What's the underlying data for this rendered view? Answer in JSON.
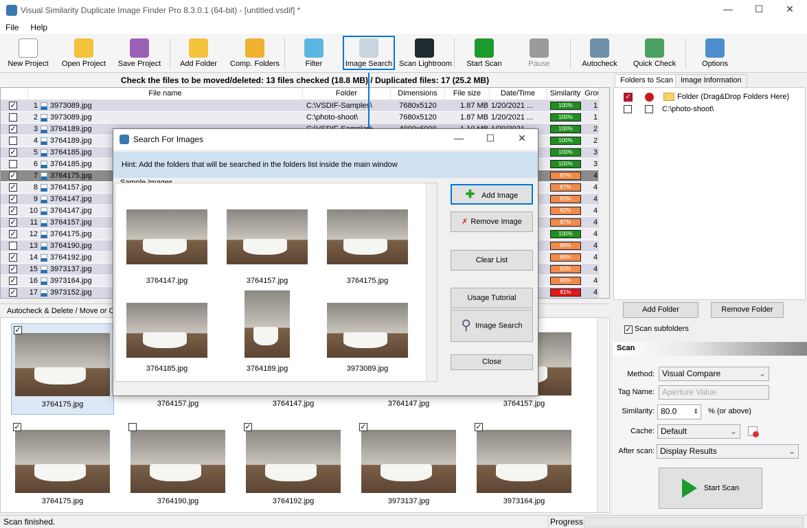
{
  "window": {
    "title": "Visual Similarity Duplicate Image Finder Pro 8.3.0.1 (64-bit) - [untitled.vsdif] *",
    "minimize": "—",
    "maximize": "☐",
    "close": "✕"
  },
  "menu": [
    "File",
    "Help"
  ],
  "toolbar": [
    {
      "label": "New Project",
      "icon": "new-project-icon",
      "color": "#ffffff"
    },
    {
      "label": "Open Project",
      "icon": "open-folder-icon",
      "color": "#f3c23a"
    },
    {
      "label": "Save Project",
      "icon": "floppy-icon",
      "color": "#9c5fb5"
    },
    {
      "label": "Add Folder",
      "icon": "add-folder-icon",
      "color": "#f3c23a"
    },
    {
      "label": "Comp. Folders",
      "icon": "compare-folders-icon",
      "color": "#f0b030"
    },
    {
      "label": "Filter",
      "icon": "funnel-icon",
      "color": "#5bb7e0"
    },
    {
      "label": "Image Search",
      "icon": "magnifier-icon",
      "color": "#c8d4e0"
    },
    {
      "label": "Scan Lightroom",
      "icon": "lightroom-icon",
      "color": "#1f2b2f"
    },
    {
      "label": "Start Scan",
      "icon": "play-icon",
      "color": "#1d9a2d"
    },
    {
      "label": "Pause",
      "icon": "pause-icon",
      "color": "#9a9a9a"
    },
    {
      "label": "Autocheck",
      "icon": "autocheck-icon",
      "color": "#6d8fa8"
    },
    {
      "label": "Quick Check",
      "icon": "quick-check-icon",
      "color": "#4aa060"
    },
    {
      "label": "Options",
      "icon": "gear-icon",
      "color": "#4c8fd0"
    }
  ],
  "summary": "Check the files to be moved/deleted: 13 files checked (18.8 MB) / Duplicated files: 17 (25.2 MB)",
  "columns": [
    "File name",
    "Folder",
    "Dimensions",
    "File size",
    "Date/Time",
    "Similarity",
    "Group"
  ],
  "rows": [
    {
      "n": "1",
      "checked": true,
      "name": "3973089.jpg",
      "folder": "C:\\VSDIF-Samples\\",
      "dims": "7680x5120",
      "size": "1.87 MB",
      "date": "1/20/2021 ...",
      "sim": "100%",
      "group": "1"
    },
    {
      "n": "2",
      "checked": false,
      "name": "3973089.jpg",
      "folder": "C:\\photo-shoot\\",
      "dims": "7680x5120",
      "size": "1.87 MB",
      "date": "1/20/2021 ...",
      "sim": "100%",
      "group": "1"
    },
    {
      "n": "3",
      "checked": true,
      "name": "3764189.jpg",
      "folder": "C:\\VSDIF-Samples\\",
      "dims": "4000x6000",
      "size": "1.10 MB",
      "date": "1/20/2021 ...",
      "sim": "100%",
      "group": "2"
    },
    {
      "n": "4",
      "checked": false,
      "name": "3764189.jpg",
      "folder": "",
      "dims": "",
      "size": "",
      "date": "",
      "sim": "100%",
      "group": "2"
    },
    {
      "n": "5",
      "checked": true,
      "name": "3764185.jpg",
      "folder": "",
      "dims": "",
      "size": "",
      "date": "",
      "sim": "100%",
      "group": "3"
    },
    {
      "n": "6",
      "checked": false,
      "name": "3764185.jpg",
      "folder": "",
      "dims": "",
      "size": "",
      "date": "",
      "sim": "100%",
      "group": "3"
    },
    {
      "n": "7",
      "checked": true,
      "name": "3764175.jpg",
      "folder": "",
      "dims": "",
      "size": "",
      "date": "",
      "sim": "87%",
      "group": "4"
    },
    {
      "n": "8",
      "checked": true,
      "name": "3764157.jpg",
      "folder": "",
      "dims": "",
      "size": "",
      "date": "",
      "sim": "87%",
      "group": "4"
    },
    {
      "n": "9",
      "checked": true,
      "name": "3764147.jpg",
      "folder": "",
      "dims": "",
      "size": "",
      "date": "",
      "sim": "83%",
      "group": "4"
    },
    {
      "n": "10",
      "checked": true,
      "name": "3764147.jpg",
      "folder": "",
      "dims": "",
      "size": "",
      "date": "",
      "sim": "82%",
      "group": "4"
    },
    {
      "n": "11",
      "checked": true,
      "name": "3764157.jpg",
      "folder": "",
      "dims": "",
      "size": "",
      "date": "",
      "sim": "87%",
      "group": "4"
    },
    {
      "n": "12",
      "checked": true,
      "name": "3764175.jpg",
      "folder": "",
      "dims": "",
      "size": "",
      "date": "",
      "sim": "100%",
      "group": "4"
    },
    {
      "n": "13",
      "checked": false,
      "name": "3764190.jpg",
      "folder": "",
      "dims": "",
      "size": "",
      "date": "",
      "sim": "89%",
      "group": "4"
    },
    {
      "n": "14",
      "checked": true,
      "name": "3764192.jpg",
      "folder": "",
      "dims": "",
      "size": "",
      "date": "",
      "sim": "86%",
      "group": "4"
    },
    {
      "n": "15",
      "checked": true,
      "name": "3973137.jpg",
      "folder": "",
      "dims": "",
      "size": "",
      "date": "",
      "sim": "83%",
      "group": "4"
    },
    {
      "n": "16",
      "checked": true,
      "name": "3973164.jpg",
      "folder": "",
      "dims": "",
      "size": "",
      "date": "",
      "sim": "86%",
      "group": "4"
    },
    {
      "n": "17",
      "checked": true,
      "name": "3973152.jpg",
      "folder": "",
      "dims": "",
      "size": "",
      "date": "",
      "sim": "81%",
      "group": "4"
    }
  ],
  "bottom_tab": "Autocheck & Delete / Move or C",
  "thumbs": [
    {
      "name": "3764175.jpg",
      "checked": true,
      "selected": true
    },
    {
      "name": "3764157.jpg",
      "checked": false
    },
    {
      "name": "3764147.jpg",
      "checked": false
    },
    {
      "name": "3764147.jpg",
      "checked": false
    },
    {
      "name": "3764157.jpg",
      "checked": false
    },
    {
      "name": "3764175.jpg",
      "checked": true
    },
    {
      "name": "3764190.jpg",
      "checked": false
    },
    {
      "name": "3764192.jpg",
      "checked": true
    },
    {
      "name": "3973137.jpg",
      "checked": true
    },
    {
      "name": "3973164.jpg",
      "checked": true
    }
  ],
  "status": {
    "text": "Scan finished.",
    "progress_label": "Progress:"
  },
  "right": {
    "tabs": [
      "Folders to Scan",
      "Image Information"
    ],
    "folders": [
      {
        "path": "Folder (Drag&Drop Folders Here)",
        "header": true
      },
      {
        "path": "C:\\photo-shoot\\",
        "header": false
      }
    ],
    "add_folder": "Add Folder",
    "remove_folder": "Remove Folder",
    "scan_subfolders": "Scan subfolders",
    "scan_subfolders_checked": true,
    "scan_title": "Scan",
    "method_label": "Method:",
    "method": "Visual Compare",
    "tag_label": "Tag Name:",
    "tag": "Aperture Value",
    "similarity_label": "Similarity:",
    "similarity": "80.0",
    "similarity_suffix": "% (or above)",
    "cache_label": "Cache:",
    "cache": "Default",
    "after_label": "After scan:",
    "after": "Display Results",
    "start_scan": "Start Scan"
  },
  "dialog": {
    "title": "Search For Images",
    "hint": "Hint: Add the folders that will be searched in the folders list inside the main window",
    "group": "Sample Images",
    "images": [
      "3764147.jpg",
      "3764157.jpg",
      "3764175.jpg",
      "3764185.jpg",
      "3764189.jpg",
      "3973089.jpg"
    ],
    "add_image": "Add Image",
    "remove_image": "Remove Image",
    "clear_list": "Clear List",
    "usage_tutorial": "Usage Tutorial",
    "image_search": "Image Search",
    "close": "Close"
  },
  "colors": {
    "sim_100": "#1f8f1f",
    "sim_high": "#f08a4a",
    "sim_low": "#e01818",
    "accent": "#0078d7"
  }
}
